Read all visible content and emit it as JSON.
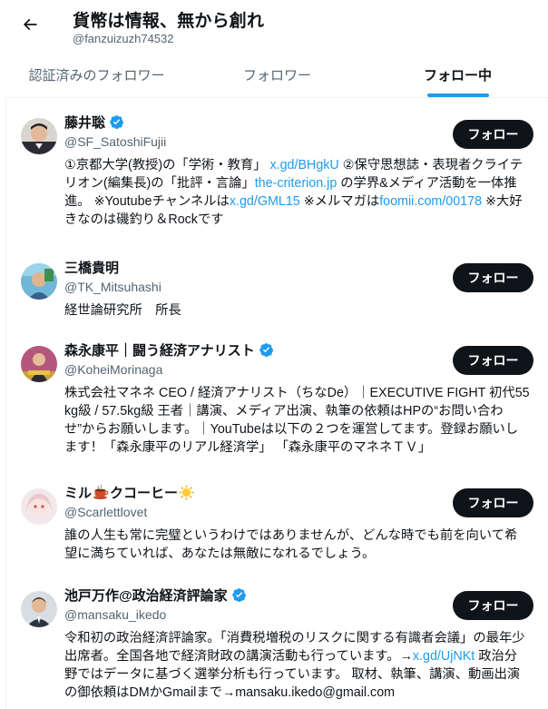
{
  "header": {
    "title": "貨幣は情報、無から創れ",
    "handle": "@fanzuizuzh74532"
  },
  "tabs": [
    {
      "label": "認証済みのフォロワー"
    },
    {
      "label": "フォロワー"
    },
    {
      "label": "フォロー中"
    }
  ],
  "follow_label": "フォロー",
  "colors": {
    "accent": "#1d9bf0",
    "text": "#0f1419",
    "muted": "#536471"
  },
  "users": [
    {
      "name": "藤井聡",
      "handle": "@SF_SatoshiFujii",
      "verified": true,
      "bio": [
        {
          "t": "①京都大学(教授)の「学術・教育」 "
        },
        {
          "t": "x.gd/BHgkU",
          "link": true
        },
        {
          "t": " ②保守思想誌・表現者クライテリオン(編集長)の「批評・言論」"
        },
        {
          "t": "the-criterion.jp",
          "link": true
        },
        {
          "t": " の学界&メディア活動を一体推進。 ※Youtubeチャンネルは"
        },
        {
          "t": "x.gd/GML15",
          "link": true
        },
        {
          "t": " ※メルマガは"
        },
        {
          "t": "foomii.com/00178",
          "link": true
        },
        {
          "t": " ※大好きなのは磯釣り＆Rockです"
        }
      ]
    },
    {
      "name": "三橋貴明",
      "handle": "@TK_Mitsuhashi",
      "verified": false,
      "bio": [
        {
          "t": "経世論研究所　所長"
        }
      ]
    },
    {
      "name": "森永康平｜闘う経済アナリスト",
      "handle": "@KoheiMorinaga",
      "verified": true,
      "bio": [
        {
          "t": "株式会社マネネ CEO / 経済アナリスト（ちなDe）｜EXECUTIVE FIGHT 初代55kg級 / 57.5kg級 王者｜講演、メディア出演、執筆の依頼はHPの“お問い合わせ”からお願いします。｜YouTubeは以下の２つを運営してます。登録お願いします！「森永康平のリアル経済学」 「森永康平のマネネＴＶ」"
        }
      ]
    },
    {
      "name": "ミルクコーヒー",
      "name_parts": [
        "ミル",
        "クコーヒー"
      ],
      "handle": "@Scarlettlovet",
      "verified": false,
      "bio": [
        {
          "t": "誰の人生も常に完璧というわけではありませんが、どんな時でも前を向いて希望に満ちていれば、あなたは無敵になれるでしょう。"
        }
      ]
    },
    {
      "name": "池戸万作@政治経済評論家",
      "handle": "@mansaku_ikedo",
      "verified": true,
      "bio": [
        {
          "t": "令和初の政治経済評論家。「消費税増税のリスクに関する有識者会議」の最年少出席者。全国各地で経済財政の講演活動も行っています。→"
        },
        {
          "t": "x.gd/UjNKt",
          "link": true
        },
        {
          "t": " 政治分野ではデータに基づく選挙分析も行っています。 取材、執筆、講演、動画出演の御依頼はDMかGmailまで→mansaku.ikedo@gmail.com"
        }
      ]
    }
  ]
}
